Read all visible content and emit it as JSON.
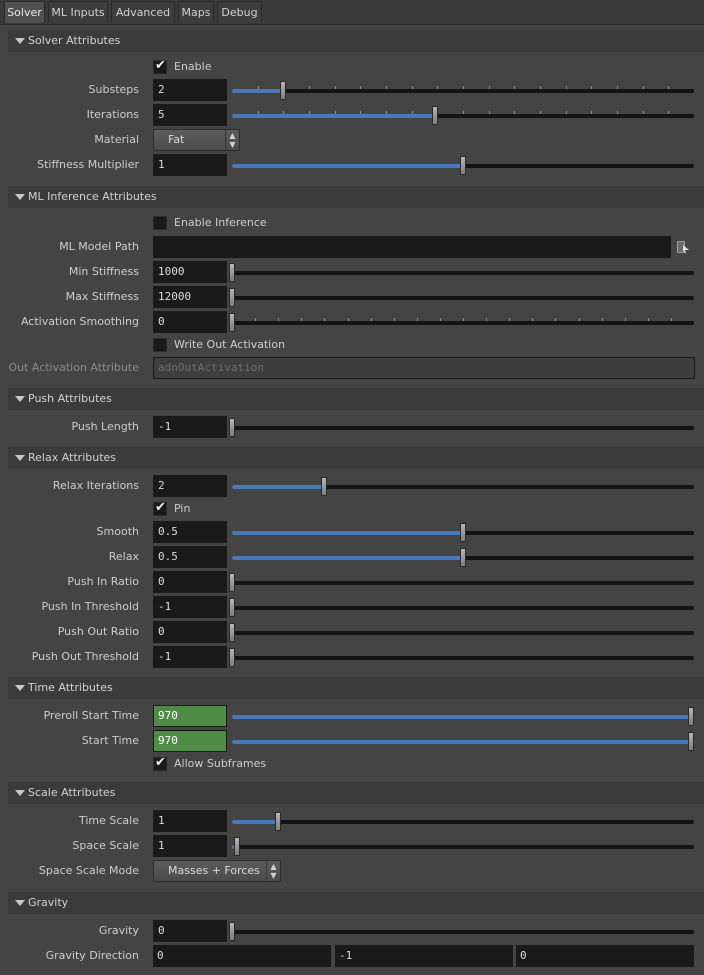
{
  "tabs": [
    {
      "label": "Solver",
      "active": true
    },
    {
      "label": "ML Inputs",
      "active": false
    },
    {
      "label": "Advanced",
      "active": false
    },
    {
      "label": "Maps",
      "active": false
    },
    {
      "label": "Debug",
      "active": false
    }
  ],
  "solver_attributes": {
    "title": "Solver Attributes",
    "enable": {
      "label": "Enable",
      "checked": true
    },
    "substeps": {
      "label": "Substeps",
      "value": "2",
      "level": 0.11
    },
    "iterations": {
      "label": "Iterations",
      "value": "5",
      "level": 0.44
    },
    "material": {
      "label": "Material",
      "value": "Fat"
    },
    "stiffness_multiplier": {
      "label": "Stiffness Multiplier",
      "value": "1",
      "level": 0.5
    }
  },
  "ml_inference_attributes": {
    "title": "ML Inference Attributes",
    "enable_inference": {
      "label": "Enable Inference",
      "checked": false
    },
    "ml_model_path": {
      "label": "ML Model Path",
      "value": ""
    },
    "min_stiffness": {
      "label": "Min Stiffness",
      "value": "1000",
      "level": 0
    },
    "max_stiffness": {
      "label": "Max Stiffness",
      "value": "12000",
      "level": 0
    },
    "activation_smoothing": {
      "label": "Activation Smoothing",
      "value": "0",
      "level": 0
    },
    "write_out_activation": {
      "label": "Write Out Activation",
      "checked": false
    },
    "out_activation_attribute": {
      "label": "Out Activation Attribute",
      "placeholder": "adnOutActivation"
    }
  },
  "push_attributes": {
    "title": "Push Attributes",
    "push_length": {
      "label": "Push Length",
      "value": "-1",
      "level": 0
    }
  },
  "relax_attributes": {
    "title": "Relax Attributes",
    "relax_iterations": {
      "label": "Relax Iterations",
      "value": "2",
      "level": 0.2
    },
    "pin": {
      "label": "Pin",
      "checked": true
    },
    "smooth": {
      "label": "Smooth",
      "value": "0.5",
      "level": 0.5
    },
    "relax": {
      "label": "Relax",
      "value": "0.5",
      "level": 0.5
    },
    "push_in_ratio": {
      "label": "Push In Ratio",
      "value": "0",
      "level": 0
    },
    "push_in_threshold": {
      "label": "Push In Threshold",
      "value": "-1",
      "level": 0
    },
    "push_out_ratio": {
      "label": "Push Out Ratio",
      "value": "0",
      "level": 0
    },
    "push_out_threshold": {
      "label": "Push Out Threshold",
      "value": "-1",
      "level": 0
    }
  },
  "time_attributes": {
    "title": "Time Attributes",
    "preroll_start_time": {
      "label": "Preroll Start Time",
      "value": "970",
      "level": 1
    },
    "start_time": {
      "label": "Start Time",
      "value": "970",
      "level": 1
    },
    "allow_subframes": {
      "label": "Allow Subframes",
      "checked": true
    }
  },
  "scale_attributes": {
    "title": "Scale Attributes",
    "time_scale": {
      "label": "Time Scale",
      "value": "1",
      "level": 0.1
    },
    "space_scale": {
      "label": "Space Scale",
      "value": "1",
      "level": 0.01
    },
    "space_scale_mode": {
      "label": "Space Scale Mode",
      "value": "Masses + Forces"
    }
  },
  "gravity": {
    "title": "Gravity",
    "gravity": {
      "label": "Gravity",
      "value": "0",
      "level": 0
    },
    "gravity_direction": {
      "label": "Gravity Direction",
      "x": "0",
      "y": "-1",
      "z": "0"
    }
  },
  "colors": {
    "accent_fill": "#4a78b8",
    "keyed_field": "#4f8c45",
    "panel": "#444444",
    "header": "#3b3b3b"
  }
}
